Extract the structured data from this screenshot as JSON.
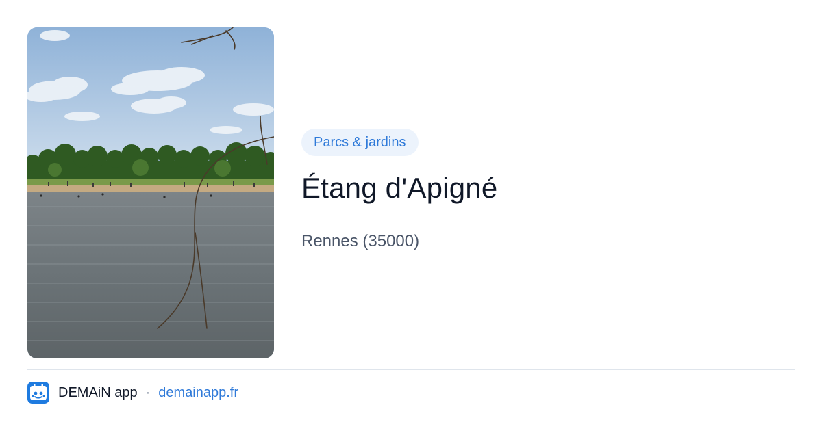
{
  "category": "Parcs & jardins",
  "title": "Étang d'Apigné",
  "location": "Rennes (35000)",
  "footer": {
    "app_name": "DEMAiN app",
    "separator": "·",
    "domain": "demainapp.fr"
  },
  "photo": {
    "subject": "lake-with-beach-and-trees"
  },
  "colors": {
    "accent": "#2f7ad9",
    "pill_background": "#ecf3fc",
    "title": "#101828",
    "subtitle": "#4a5568",
    "divider": "#dfe5ec"
  },
  "icons": {
    "app_logo": "demain-app-logo-icon"
  }
}
